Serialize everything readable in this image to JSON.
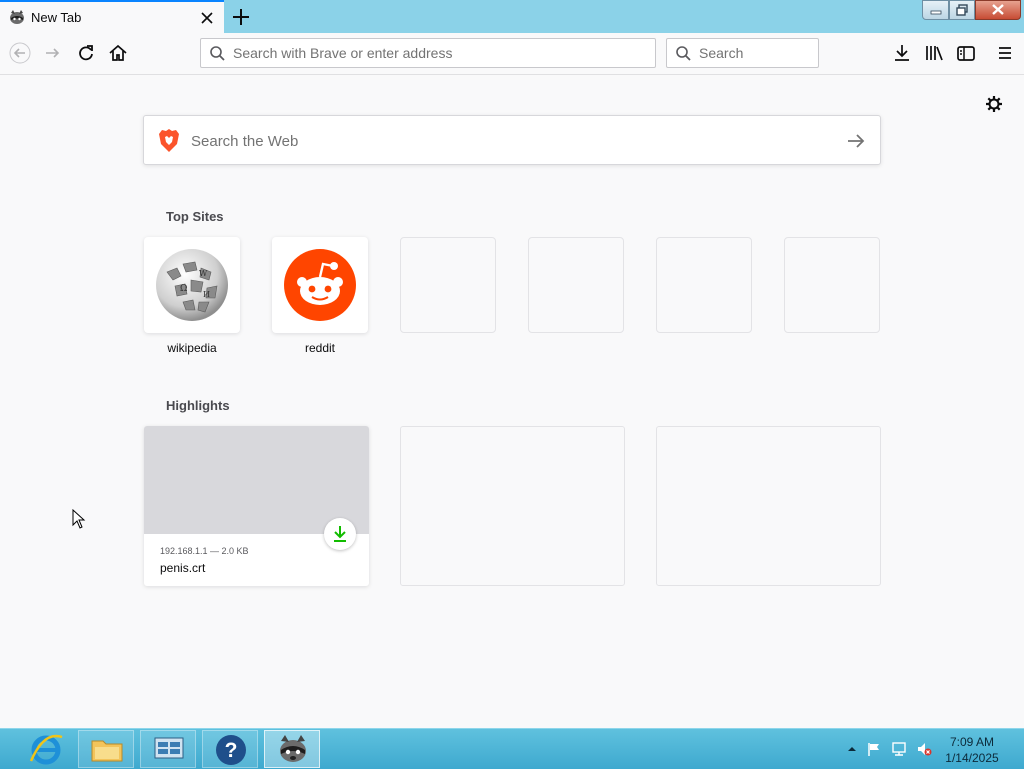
{
  "tab": {
    "title": "New Tab"
  },
  "toolbar": {
    "url_placeholder": "Search with Brave or enter address",
    "search_placeholder": "Search"
  },
  "websearch": {
    "placeholder": "Search the Web"
  },
  "top_sites": {
    "heading": "Top Sites",
    "items": [
      {
        "label": "wikipedia",
        "icon": "wikipedia-icon"
      },
      {
        "label": "reddit",
        "icon": "reddit-icon"
      }
    ]
  },
  "highlights": {
    "heading": "Highlights",
    "items": [
      {
        "meta": "192.168.1.1 — 2.0 KB",
        "title": "penis.crt",
        "icon": "download-icon"
      }
    ]
  },
  "taskbar": {
    "time": "7:09 AM",
    "date": "1/14/2025"
  },
  "colors": {
    "tabstrip": "#8bd2e8",
    "accent": "#0a84ff",
    "reddit": "#ff4500",
    "download_green": "#12bc00",
    "taskbar": "#4fb6d8"
  }
}
